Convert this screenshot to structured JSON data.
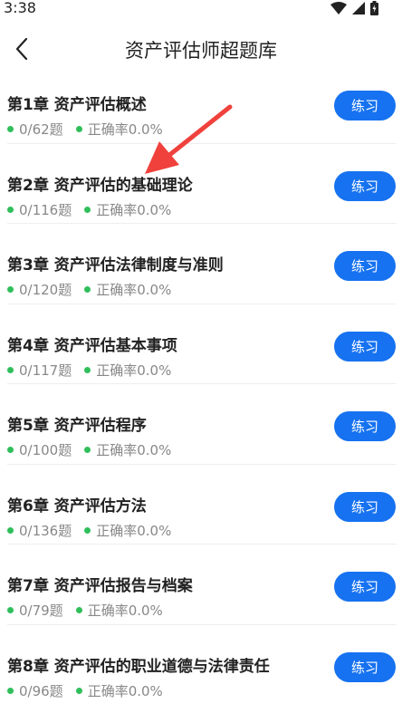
{
  "status_bar": {
    "time": "3:38"
  },
  "header": {
    "title": "资产评估师超题库"
  },
  "colors": {
    "accent": "#1672f0",
    "dot": "#2fbf5a",
    "arrow": "#f0413c"
  },
  "chapters": [
    {
      "title": "第1章 资产评估概述",
      "progress": "0/62题",
      "accuracy": "正确率0.0%",
      "button": "练习"
    },
    {
      "title": "第2章 资产评估的基础理论",
      "progress": "0/116题",
      "accuracy": "正确率0.0%",
      "button": "练习"
    },
    {
      "title": "第3章 资产评估法律制度与准则",
      "progress": "0/120题",
      "accuracy": "正确率0.0%",
      "button": "练习"
    },
    {
      "title": "第4章 资产评估基本事项",
      "progress": "0/117题",
      "accuracy": "正确率0.0%",
      "button": "练习"
    },
    {
      "title": "第5章 资产评估程序",
      "progress": "0/100题",
      "accuracy": "正确率0.0%",
      "button": "练习"
    },
    {
      "title": "第6章 资产评估方法",
      "progress": "0/136题",
      "accuracy": "正确率0.0%",
      "button": "练习"
    },
    {
      "title": "第7章 资产评估报告与档案",
      "progress": "0/79题",
      "accuracy": "正确率0.0%",
      "button": "练习"
    },
    {
      "title": "第8章 资产评估的职业道德与法律责任",
      "progress": "0/96题",
      "accuracy": "正确率0.0%",
      "button": "练习"
    }
  ]
}
